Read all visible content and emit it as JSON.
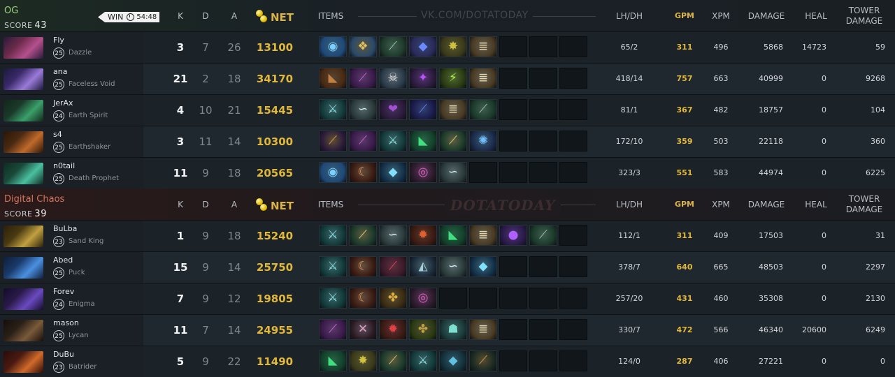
{
  "headers": {
    "k": "K",
    "d": "D",
    "a": "A",
    "net": "NET",
    "items": "ITEMS",
    "lhdh": "LH/DH",
    "gpm": "GPM",
    "xpm": "XPM",
    "damage": "DAMAGE",
    "heal": "HEAL",
    "tower_line1": "TOWER",
    "tower_line2": "DAMAGE"
  },
  "colors": {
    "team1": "#9fd27a",
    "team2": "#d6735c",
    "gold": "#e2b83a"
  },
  "teams": [
    {
      "name": "OG",
      "score_label": "SCORE",
      "score": "43",
      "result": "WIN",
      "duration": "54:48",
      "watermark": "VK.COM/DOTATODAY",
      "players": [
        {
          "name": "Fly",
          "level": "25",
          "hero": "Dazzle",
          "k": "3",
          "d": "7",
          "a": "26",
          "net": "13100",
          "lhdh": "65/2",
          "gpm": "311",
          "xpm": "496",
          "damage": "5868",
          "heal": "14723",
          "tower": "59",
          "portrait": [
            "#6b2a4a",
            "#b4508c",
            "#2a1a3a"
          ],
          "items": [
            [
              "blue-orb-icon",
              "#1e4a7a",
              "◉",
              "#7ad0ff"
            ],
            [
              "gem-icon",
              "#2a4a6a",
              "❖",
              "#e0c060"
            ],
            [
              "staff-icon",
              "#1e3a2a",
              "⟋",
              "#8fd0a0"
            ],
            [
              "boots-icon",
              "#2a2a5a",
              "◆",
              "#6a8aff"
            ],
            [
              "wraith-icon",
              "#3a3a1a",
              "✸",
              "#d0c040"
            ],
            [
              "scroll-icon",
              "#4a3a22",
              "≣",
              "#e8d6a8"
            ],
            null,
            null,
            null
          ]
        },
        {
          "name": "ana",
          "level": "25",
          "hero": "Faceless Void",
          "k": "21",
          "d": "2",
          "a": "18",
          "net": "34170",
          "lhdh": "418/14",
          "gpm": "757",
          "xpm": "663",
          "damage": "40999",
          "heal": "0",
          "tower": "9268",
          "portrait": [
            "#3a2a6a",
            "#9a7ad8",
            "#1a1a3a"
          ],
          "items": [
            [
              "boots-icon",
              "#4a2a12",
              "◣",
              "#c08040"
            ],
            [
              "blade-icon",
              "#3a1a4a",
              "⟋",
              "#d060e0"
            ],
            [
              "skull-icon",
              "#2a3a4a",
              "☠",
              "#e0e8f0"
            ],
            [
              "dagger-icon",
              "#2a1a3a",
              "✦",
              "#c050ff"
            ],
            [
              "claw-icon",
              "#2a3a12",
              "⚡",
              "#b0f040"
            ],
            [
              "scroll-icon",
              "#4a3a22",
              "≣",
              "#e8d6a8"
            ],
            null,
            null,
            null
          ]
        },
        {
          "name": "JerAx",
          "level": "24",
          "hero": "Earth Spirit",
          "k": "4",
          "d": "10",
          "a": "21",
          "net": "15445",
          "lhdh": "81/1",
          "gpm": "367",
          "xpm": "482",
          "damage": "18757",
          "heal": "0",
          "tower": "104",
          "portrait": [
            "#1a3a2a",
            "#3aa06a",
            "#12261a"
          ],
          "items": [
            [
              "axe-icon",
              "#123a3a",
              "⚔",
              "#80e0e0"
            ],
            [
              "wind-icon",
              "#2a3a3a",
              "∽",
              "#d0f0f0"
            ],
            [
              "heart-icon",
              "#2a1a3a",
              "❤",
              "#a050d0"
            ],
            [
              "staff-icon",
              "#1a1a4a",
              "⟋",
              "#6080ff"
            ],
            [
              "scroll-icon",
              "#4a3a22",
              "≣",
              "#e8d6a8"
            ],
            [
              "wand-icon",
              "#1a3a2a",
              "⟋",
              "#90d0a0"
            ],
            null,
            null,
            null
          ]
        },
        {
          "name": "s4",
          "level": "25",
          "hero": "Earthshaker",
          "k": "3",
          "d": "11",
          "a": "14",
          "net": "10300",
          "lhdh": "172/10",
          "gpm": "359",
          "xpm": "503",
          "damage": "22118",
          "heal": "0",
          "tower": "360",
          "portrait": [
            "#4a2a12",
            "#c06a2a",
            "#2a1608"
          ],
          "items": [
            [
              "stick-icon",
              "#2a1a3a",
              "⟋",
              "#e0a040"
            ],
            [
              "blade-icon",
              "#3a1a4a",
              "⟋",
              "#d060e0"
            ],
            [
              "axe-icon",
              "#123a3a",
              "⚔",
              "#80e0e0"
            ],
            [
              "boots-icon",
              "#12402a",
              "◣",
              "#40e080"
            ],
            [
              "staff-icon",
              "#1a3a2a",
              "⟋",
              "#e0d070"
            ],
            [
              "orb-icon",
              "#1a2a4a",
              "✺",
              "#70c0ff"
            ],
            null,
            null,
            null
          ]
        },
        {
          "name": "n0tail",
          "level": "25",
          "hero": "Death Prophet",
          "k": "11",
          "d": "9",
          "a": "18",
          "net": "20565",
          "lhdh": "323/3",
          "gpm": "551",
          "xpm": "583",
          "damage": "44974",
          "heal": "0",
          "tower": "6225",
          "portrait": [
            "#1a4a3a",
            "#4ac0a0",
            "#102a22"
          ],
          "items": [
            [
              "blue-orb-icon",
              "#1e4a7a",
              "◉",
              "#7ad0ff"
            ],
            [
              "claw-icon",
              "#3a1a12",
              "☾",
              "#f0a060"
            ],
            [
              "crystal-icon",
              "#12304a",
              "◆",
              "#80e0ff"
            ],
            [
              "orb-icon",
              "#2a1a2a",
              "◎",
              "#e060c0"
            ],
            [
              "wind-icon",
              "#2a3a3a",
              "∽",
              "#d0f0f0"
            ],
            null,
            null,
            null,
            null
          ]
        }
      ]
    },
    {
      "name": "Digital Chaos",
      "score_label": "SCORE",
      "score": "39",
      "watermark": "DOTATODAY",
      "players": [
        {
          "name": "BuLba",
          "level": "23",
          "hero": "Sand King",
          "k": "1",
          "d": "9",
          "a": "18",
          "net": "15240",
          "lhdh": "112/1",
          "gpm": "311",
          "xpm": "409",
          "damage": "17503",
          "heal": "0",
          "tower": "31",
          "portrait": [
            "#4a3a12",
            "#c0a040",
            "#2a200a"
          ],
          "items": [
            [
              "axe-icon",
              "#123a3a",
              "⚔",
              "#80e0e0"
            ],
            [
              "staff-icon",
              "#1a3a2a",
              "⟋",
              "#e0d070"
            ],
            [
              "wind-icon",
              "#2a3a3a",
              "∽",
              "#d0f0f0"
            ],
            [
              "mask-icon",
              "#3a1a12",
              "✹",
              "#e06030"
            ],
            [
              "boots-icon",
              "#12402a",
              "◣",
              "#40e080"
            ],
            [
              "scroll-icon",
              "#4a3a22",
              "≣",
              "#e8d6a8"
            ],
            [
              "potion-icon",
              "#2a1a4a",
              "●",
              "#b060ff"
            ],
            [
              "wand-icon",
              "#1a3a2a",
              "⟋",
              "#90d0a0"
            ],
            null
          ]
        },
        {
          "name": "Abed",
          "level": "25",
          "hero": "Puck",
          "k": "15",
          "d": "9",
          "a": "14",
          "net": "25750",
          "lhdh": "378/7",
          "gpm": "640",
          "xpm": "665",
          "damage": "48503",
          "heal": "0",
          "tower": "2297",
          "portrait": [
            "#1a3a6a",
            "#4a90e0",
            "#101e3a"
          ],
          "items": [
            [
              "axe-icon",
              "#123a3a",
              "⚔",
              "#80e0e0"
            ],
            [
              "claw-icon",
              "#3a1a12",
              "☾",
              "#f0a060"
            ],
            [
              "blade-icon",
              "#3a1a2a",
              "⟋",
              "#e04060"
            ],
            [
              "shield-icon",
              "#1a2a3a",
              "◭",
              "#a0d0e0"
            ],
            [
              "wind-icon",
              "#2a3a3a",
              "∽",
              "#d0f0f0"
            ],
            [
              "crystal-icon",
              "#12304a",
              "◆",
              "#80e0ff"
            ],
            null,
            null,
            null
          ]
        },
        {
          "name": "Forev",
          "level": "24",
          "hero": "Enigma",
          "k": "7",
          "d": "9",
          "a": "12",
          "net": "19805",
          "lhdh": "257/20",
          "gpm": "431",
          "xpm": "460",
          "damage": "35308",
          "heal": "0",
          "tower": "2130",
          "portrait": [
            "#2a1a4a",
            "#6a4ac0",
            "#140c2a"
          ],
          "items": [
            [
              "axe-icon",
              "#123a3a",
              "⚔",
              "#80e0e0"
            ],
            [
              "claw-icon",
              "#3a1a12",
              "☾",
              "#f0a060"
            ],
            [
              "armor-icon",
              "#3a2a12",
              "✤",
              "#e0b040"
            ],
            [
              "orb-icon",
              "#2a1a2a",
              "◎",
              "#e060c0"
            ],
            null,
            null,
            null,
            null,
            null
          ]
        },
        {
          "name": "mason",
          "level": "25",
          "hero": "Lycan",
          "k": "11",
          "d": "7",
          "a": "14",
          "net": "24955",
          "lhdh": "330/7",
          "gpm": "472",
          "xpm": "566",
          "damage": "46340",
          "heal": "20600",
          "tower": "6249",
          "portrait": [
            "#2a2018",
            "#7a5a3a",
            "#140e0a"
          ],
          "items": [
            [
              "blade-icon",
              "#3a1a4a",
              "⟋",
              "#d060e0"
            ],
            [
              "cleaver-icon",
              "#2a1a22",
              "✕",
              "#e0a0c0"
            ],
            [
              "mask-icon",
              "#3a1a12",
              "✹",
              "#e04040"
            ],
            [
              "armor-icon",
              "#2a3a12",
              "✤",
              "#c0a040"
            ],
            [
              "helm-icon",
              "#1a3a3a",
              "☗",
              "#80e0d0"
            ],
            [
              "scroll-icon",
              "#4a3a22",
              "≣",
              "#e8d6a8"
            ],
            null,
            null,
            null
          ]
        },
        {
          "name": "DuBu",
          "level": "23",
          "hero": "Batrider",
          "k": "5",
          "d": "9",
          "a": "22",
          "net": "11490",
          "lhdh": "124/0",
          "gpm": "287",
          "xpm": "406",
          "damage": "27221",
          "heal": "0",
          "tower": "0",
          "portrait": [
            "#4a1a12",
            "#d06a2a",
            "#2a0c08"
          ],
          "items": [
            [
              "boots-icon",
              "#12402a",
              "◣",
              "#40e080"
            ],
            [
              "wraith-icon",
              "#3a3a1a",
              "✸",
              "#d0c040"
            ],
            [
              "staff-icon",
              "#1a3a2a",
              "⟋",
              "#e0d070"
            ],
            [
              "axe-icon",
              "#123a3a",
              "⚔",
              "#80e0e0"
            ],
            [
              "shard-icon",
              "#12303a",
              "◆",
              "#60c0e0"
            ],
            [
              "bow-icon",
              "#1a2a22",
              "⟋",
              "#d0a040"
            ],
            null,
            null,
            null
          ]
        }
      ]
    }
  ]
}
